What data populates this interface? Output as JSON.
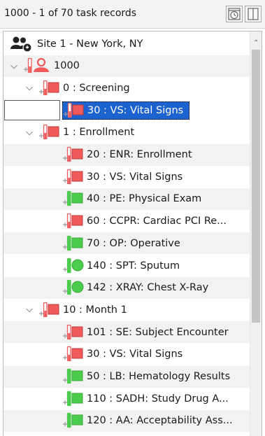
{
  "header": {
    "title": "1000 - 1 of 70 task records",
    "btn_timer_icon": "clock-calendar-icon",
    "btn_panel_icon": "split-panel-icon"
  },
  "colors": {
    "status_red": "#f05a5a",
    "status_green": "#4ccc4c",
    "selection": "#1d63d0"
  },
  "tree": {
    "site": {
      "label": "Site 1 - New York, NY",
      "icon": "site-users-icon"
    },
    "subject": {
      "label": "1000",
      "icon": "subject-person-icon"
    },
    "visits": [
      {
        "label": "0 : Screening",
        "status": "red",
        "forms": [
          {
            "label": "30 : VS: Vital Signs",
            "status": "red",
            "shape": "square",
            "selected": true
          }
        ]
      },
      {
        "label": "1 : Enrollment",
        "status": "red",
        "forms": [
          {
            "label": "20 : ENR: Enrollment",
            "status": "red",
            "shape": "square"
          },
          {
            "label": "30 : VS: Vital Signs",
            "status": "red",
            "shape": "square"
          },
          {
            "label": "40 : PE: Physical Exam",
            "status": "green",
            "shape": "square"
          },
          {
            "label": "60 : CCPR: Cardiac PCI Re...",
            "status": "red",
            "shape": "square"
          },
          {
            "label": "70 : OP: Operative",
            "status": "green",
            "shape": "square"
          },
          {
            "label": "140 : SPT: Sputum",
            "status": "green",
            "shape": "circle"
          },
          {
            "label": "142 : XRAY: Chest X-Ray",
            "status": "green",
            "shape": "circle"
          }
        ]
      },
      {
        "label": "10 : Month 1",
        "status": "red",
        "forms": [
          {
            "label": "101 : SE: Subject Encounter",
            "status": "red",
            "shape": "square"
          },
          {
            "label": "30 : VS: Vital Signs",
            "status": "red",
            "shape": "square"
          },
          {
            "label": "50 : LB: Hematology Results",
            "status": "green",
            "shape": "square"
          },
          {
            "label": "110 : SADH: Study Drug A...",
            "status": "green",
            "shape": "square"
          },
          {
            "label": "120 : AA: Acceptability Ass...",
            "status": "green",
            "shape": "square"
          }
        ]
      }
    ]
  }
}
